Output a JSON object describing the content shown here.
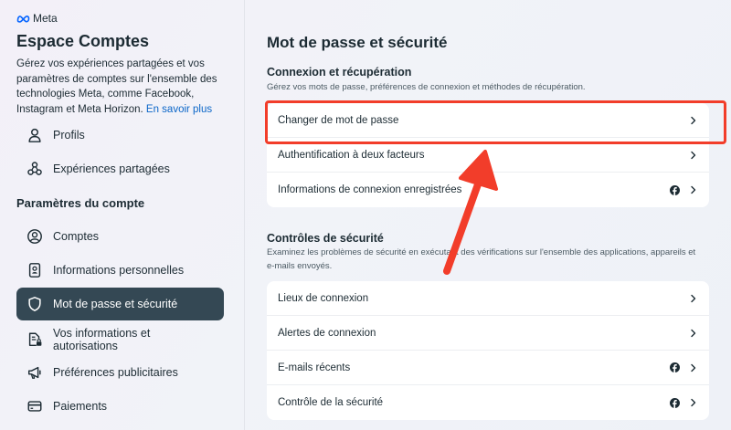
{
  "sidebar": {
    "logo": "Meta",
    "title": "Espace Comptes",
    "description": "Gérez vos expériences partagées et vos paramètres de comptes sur l'ensemble des technologies Meta, comme Facebook, Instagram et Meta Horizon.",
    "learn_more": "En savoir plus",
    "items_top": [
      {
        "label": "Profils",
        "icon": "user-icon"
      },
      {
        "label": "Expériences partagées",
        "icon": "shared-experiences-icon"
      }
    ],
    "section_title": "Paramètres du compte",
    "items": [
      {
        "label": "Comptes",
        "icon": "account-circle-icon"
      },
      {
        "label": "Informations personnelles",
        "icon": "id-card-icon"
      },
      {
        "label": "Mot de passe et sécurité",
        "icon": "shield-icon",
        "active": true
      },
      {
        "label": "Vos informations et autorisations",
        "icon": "document-lock-icon"
      },
      {
        "label": "Préférences publicitaires",
        "icon": "megaphone-icon"
      },
      {
        "label": "Paiements",
        "icon": "credit-card-icon"
      }
    ]
  },
  "main": {
    "title": "Mot de passe et sécurité",
    "sections": [
      {
        "title": "Connexion et récupération",
        "description": "Gérez vos mots de passe, préférences de connexion et méthodes de récupération.",
        "rows": [
          {
            "label": "Changer de mot de passe",
            "facebook_icon": false
          },
          {
            "label": "Authentification à deux facteurs",
            "facebook_icon": false
          },
          {
            "label": "Informations de connexion enregistrées",
            "facebook_icon": true
          }
        ]
      },
      {
        "title": "Contrôles de sécurité",
        "description": "Examinez les problèmes de sécurité en exécutant des vérifications sur l'ensemble des applications, appareils et e-mails envoyés.",
        "rows": [
          {
            "label": "Lieux de connexion",
            "facebook_icon": false
          },
          {
            "label": "Alertes de connexion",
            "facebook_icon": false
          },
          {
            "label": "E-mails récents",
            "facebook_icon": true
          },
          {
            "label": "Contrôle de la sécurité",
            "facebook_icon": true
          }
        ]
      }
    ]
  },
  "colors": {
    "accent_active": "#344854",
    "link": "#0a66c8",
    "annotation": "#f23d2a"
  }
}
